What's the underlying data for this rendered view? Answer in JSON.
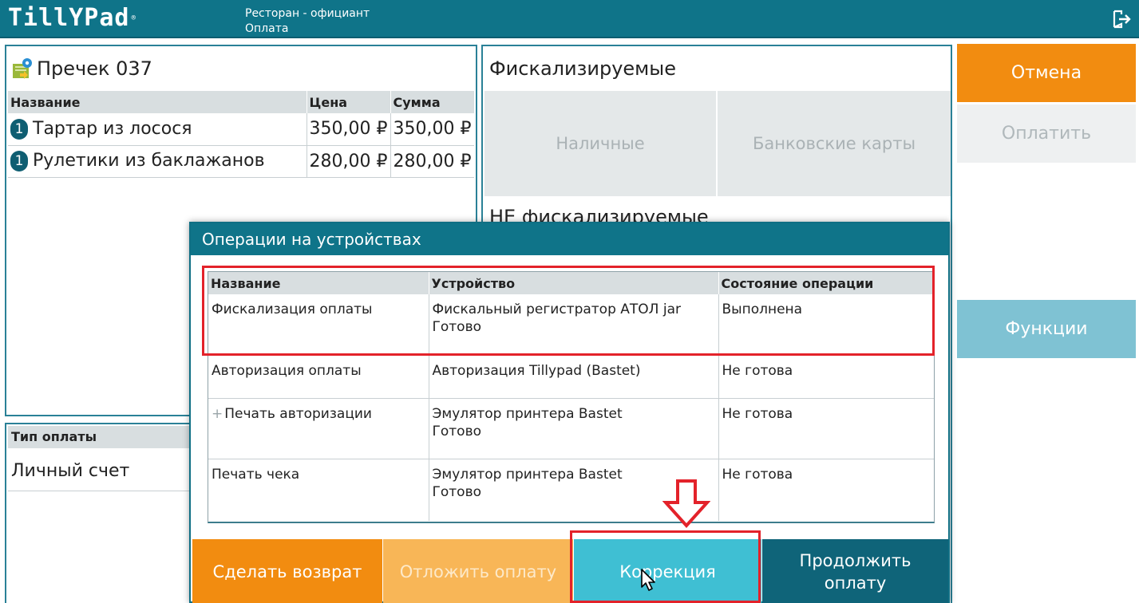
{
  "header": {
    "logo": "TillYPad",
    "breadcrumb_app": "Ресторан - официант",
    "breadcrumb_page": "Оплата",
    "exit_icon": "logout-icon"
  },
  "check": {
    "title": "Пречек 037",
    "icon": "receipt-icon",
    "columns": [
      "Название",
      "Цена",
      "Сумма"
    ],
    "items": [
      {
        "qty": "1",
        "name": "Тартар из лосося",
        "price": "350,00 ₽",
        "sum": "350,00 ₽"
      },
      {
        "qty": "1",
        "name": "Рулетики из баклажанов",
        "price": "280,00 ₽",
        "sum": "280,00 ₽"
      }
    ]
  },
  "payment_type": {
    "header": "Тип оплаты",
    "value": "Личный счет"
  },
  "middle": {
    "fiscal_title": "Фискализируемые",
    "cash_label": "Наличные",
    "card_label": "Банковские карты",
    "nonfiscal_title": "НЕ фискализируемые"
  },
  "right": {
    "cancel_label": "Отмена",
    "pay_label": "Оплатить",
    "functions_label": "Функции"
  },
  "modal": {
    "title": "Операции на устройствах",
    "columns": [
      "Название",
      "Устройство",
      "Состояние операции"
    ],
    "rows": [
      {
        "name": "Фискализация оплаты",
        "device": "Фискальный регистратор АТОЛ jar",
        "device_status": "Готово",
        "state": "Выполнена"
      },
      {
        "name": "Авторизация оплаты",
        "device": "Авторизация Tillypad (Bastet)",
        "device_status": "",
        "state": "Не готова"
      },
      {
        "name": "Печать авторизации",
        "device": "Эмулятор принтера Bastet",
        "device_status": "Готово",
        "state": "Не готова"
      },
      {
        "name": "Печать чека",
        "device": "Эмулятор принтера Bastet",
        "device_status": "Готово",
        "state": "Не готова"
      }
    ],
    "buttons": {
      "return_label": "Сделать возврат",
      "defer_label": "Отложить оплату",
      "correction_label": "Коррекция",
      "continue_line1": "Продолжить",
      "continue_line2": "оплату"
    }
  },
  "colors": {
    "header": "#0f7489",
    "orange": "#f28c10",
    "light_orange": "#f8b657",
    "cyan": "#3fbfd3",
    "dark_teal": "#0f6479",
    "highlight": "#e3222a"
  }
}
